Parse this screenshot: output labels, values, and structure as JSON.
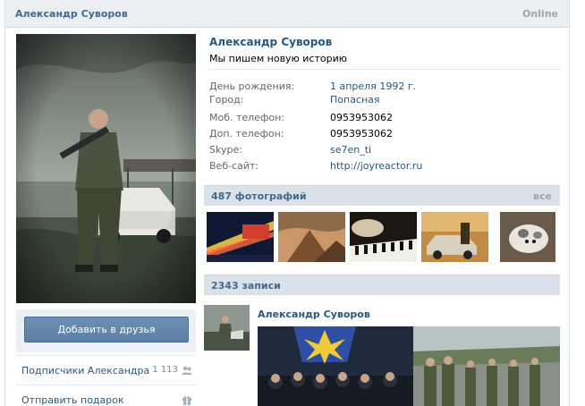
{
  "header": {
    "name": "Александр Суворов",
    "status": "Online"
  },
  "profile": {
    "name": "Александр Суворов",
    "status_text": "Мы пишем новую историю",
    "info": [
      {
        "key": "День рождения:",
        "value": "1 апреля 1992 г.",
        "link": true
      },
      {
        "key": "Город:",
        "value": "Попасная",
        "link": true
      },
      {
        "key": "Моб. телефон:",
        "value": "0953953062",
        "link": false
      },
      {
        "key": "Доп. телефон:",
        "value": "0953953062",
        "link": false
      },
      {
        "key": "Skype:",
        "value": "se7en_ti",
        "link": true
      },
      {
        "key": "Веб-сайт:",
        "value": "http://joyreactor.ru",
        "link": true
      }
    ]
  },
  "left": {
    "add_friend_label": "Добавить в друзья",
    "subscribers_label": "Подписчики Александра",
    "subscribers_count": "1 113",
    "gift_label": "Отправить подарок"
  },
  "photos": {
    "title": "487 фотографий",
    "all_label": "все"
  },
  "wall": {
    "title": "2343 записи",
    "post_author": "Александр Суворов"
  },
  "colors": {
    "link": "#2b587a",
    "header_bg": "#eceff2",
    "section_bg": "#dae1e8",
    "button": "#5b7fa6"
  },
  "icons": {
    "subscribers": "people-icon",
    "gift": "gift-icon"
  }
}
